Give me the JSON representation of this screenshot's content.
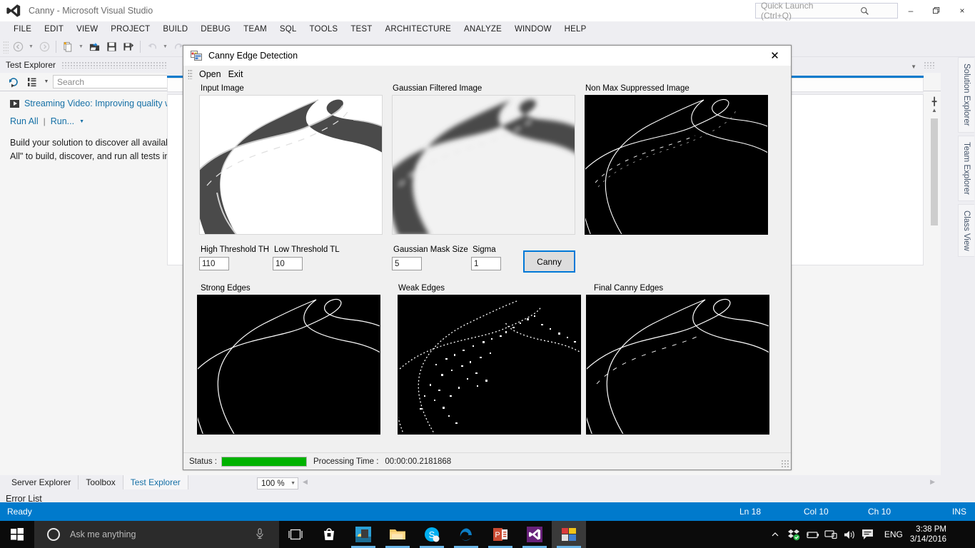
{
  "vs": {
    "title": "Canny - Microsoft Visual Studio",
    "quick_launch_placeholder": "Quick Launch (Ctrl+Q)",
    "menu": [
      "FILE",
      "EDIT",
      "VIEW",
      "PROJECT",
      "BUILD",
      "DEBUG",
      "TEAM",
      "SQL",
      "TOOLS",
      "TEST",
      "ARCHITECTURE",
      "ANALYZE",
      "WINDOW",
      "HELP"
    ],
    "window_buttons": {
      "minimize": "–",
      "restore": "❐",
      "close": "×"
    },
    "test_explorer": {
      "title": "Test Explorer",
      "search_placeholder": "Search",
      "link": "Streaming Video: Improving quality with u",
      "run_all": "Run All",
      "run": "Run...",
      "description_line1": "Build your solution to discover all available te",
      "description_line2": "All\" to build, discover, and run all tests in your"
    },
    "vertical_tabs": [
      "Solution Explorer",
      "Team Explorer",
      "Class View"
    ],
    "dock_tabs": [
      {
        "label": "Server Explorer",
        "active": false
      },
      {
        "label": "Toolbox",
        "active": false
      },
      {
        "label": "Test Explorer",
        "active": true
      }
    ],
    "error_list": "Error List",
    "zoom": "100 %",
    "status": {
      "ready": "Ready",
      "line": "Ln 18",
      "col": "Col 10",
      "ch": "Ch 10",
      "ins": "INS"
    },
    "accent": "#007acc"
  },
  "dialog": {
    "title": "Canny Edge Detection",
    "close_glyph": "✕",
    "menu": [
      "Open",
      "Exit"
    ],
    "panels": [
      {
        "label": "Input Image",
        "kind": "photo"
      },
      {
        "label": "Gaussian Filtered Image",
        "kind": "blurred"
      },
      {
        "label": "Non Max Suppressed Image",
        "kind": "edges"
      },
      {
        "label": "Strong Edges",
        "kind": "edges"
      },
      {
        "label": "Weak Edges",
        "kind": "noisy"
      },
      {
        "label": "Final Canny Edges",
        "kind": "edges"
      }
    ],
    "fields": [
      {
        "label": "High Threshold TH",
        "value": "110"
      },
      {
        "label": "Low Threshold TL",
        "value": "10"
      },
      {
        "label": "Gaussian Mask Size",
        "value": "5"
      },
      {
        "label": "Sigma",
        "value": "1"
      }
    ],
    "run_button": "Canny",
    "status_label": "Status :",
    "progress_percent": 100,
    "progress_color": "#00b200",
    "processing_time_label": "Processing Time :",
    "processing_time_value": "00:00:00.2181868"
  },
  "taskbar": {
    "cortana_placeholder": "Ask me anything",
    "apps": [
      "store-icon",
      "photos-icon",
      "file-explorer-icon",
      "skype-icon",
      "edge-icon",
      "powerpoint-icon",
      "visual-studio-icon",
      "canny-app-icon"
    ],
    "language": "ENG",
    "time": "3:38 PM",
    "date": "3/14/2016"
  }
}
